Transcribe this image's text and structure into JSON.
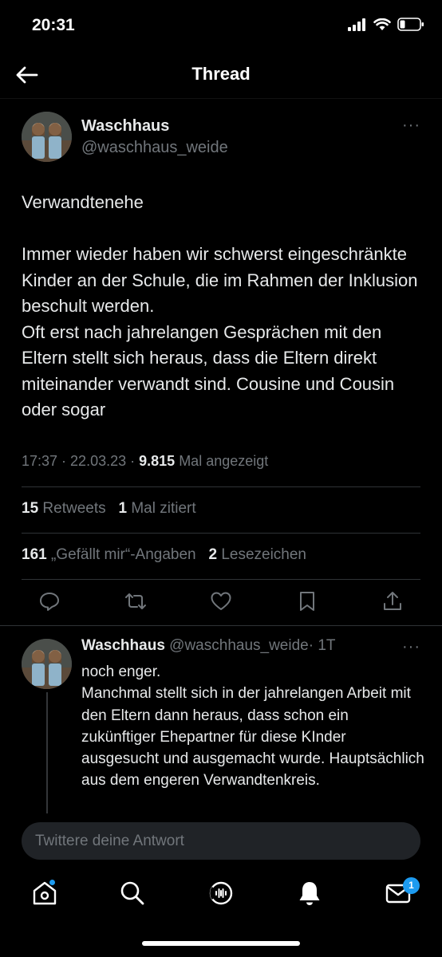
{
  "status_bar": {
    "time": "20:31"
  },
  "header": {
    "title": "Thread"
  },
  "main_tweet": {
    "display_name": "Waschhaus",
    "handle": "@waschhaus_weide",
    "more": "···",
    "text": "Verwandtenehe\n\nImmer wieder haben wir schwerst eingeschränkte Kinder an der Schule, die im Rahmen der Inklusion beschult werden.\nOft erst nach jahrelangen Gesprächen mit den Eltern stellt sich heraus, dass die Eltern direkt miteinander verwandt sind. Cousine und Cousin oder sogar",
    "time": "17:37",
    "date": "22.03.23",
    "views": "9.815",
    "views_label": "Mal angezeigt",
    "retweets": "15",
    "retweets_label": "Retweets",
    "quotes": "1",
    "quotes_label": "Mal zitiert",
    "likes": "161",
    "likes_label": "„Gefällt mir“-Angaben",
    "bookmarks": "2",
    "bookmarks_label": "Lesezeichen"
  },
  "reply_tweet": {
    "display_name": "Waschhaus",
    "handle": "@waschhaus_weide",
    "age": "· 1T",
    "more": "···",
    "text": "noch enger.\nManchmal stellt sich in der jahrelangen Arbeit mit den Eltern dann heraus, dass schon ein zukünftiger Ehepartner für diese KInder ausgesucht und ausgemacht wurde. Hauptsächlich aus dem engeren Verwandtenkreis."
  },
  "composer": {
    "placeholder": "Twittere deine Antwort"
  },
  "tab_bar": {
    "messages_badge": "1"
  },
  "colors": {
    "accent": "#1d9bf0",
    "background": "#000000",
    "secondary_text": "#71767b"
  },
  "icons": [
    "back-arrow-icon",
    "reply-icon",
    "retweet-icon",
    "like-icon",
    "bookmark-icon",
    "share-icon",
    "home-icon",
    "search-icon",
    "spaces-icon",
    "notifications-icon",
    "messages-icon"
  ]
}
